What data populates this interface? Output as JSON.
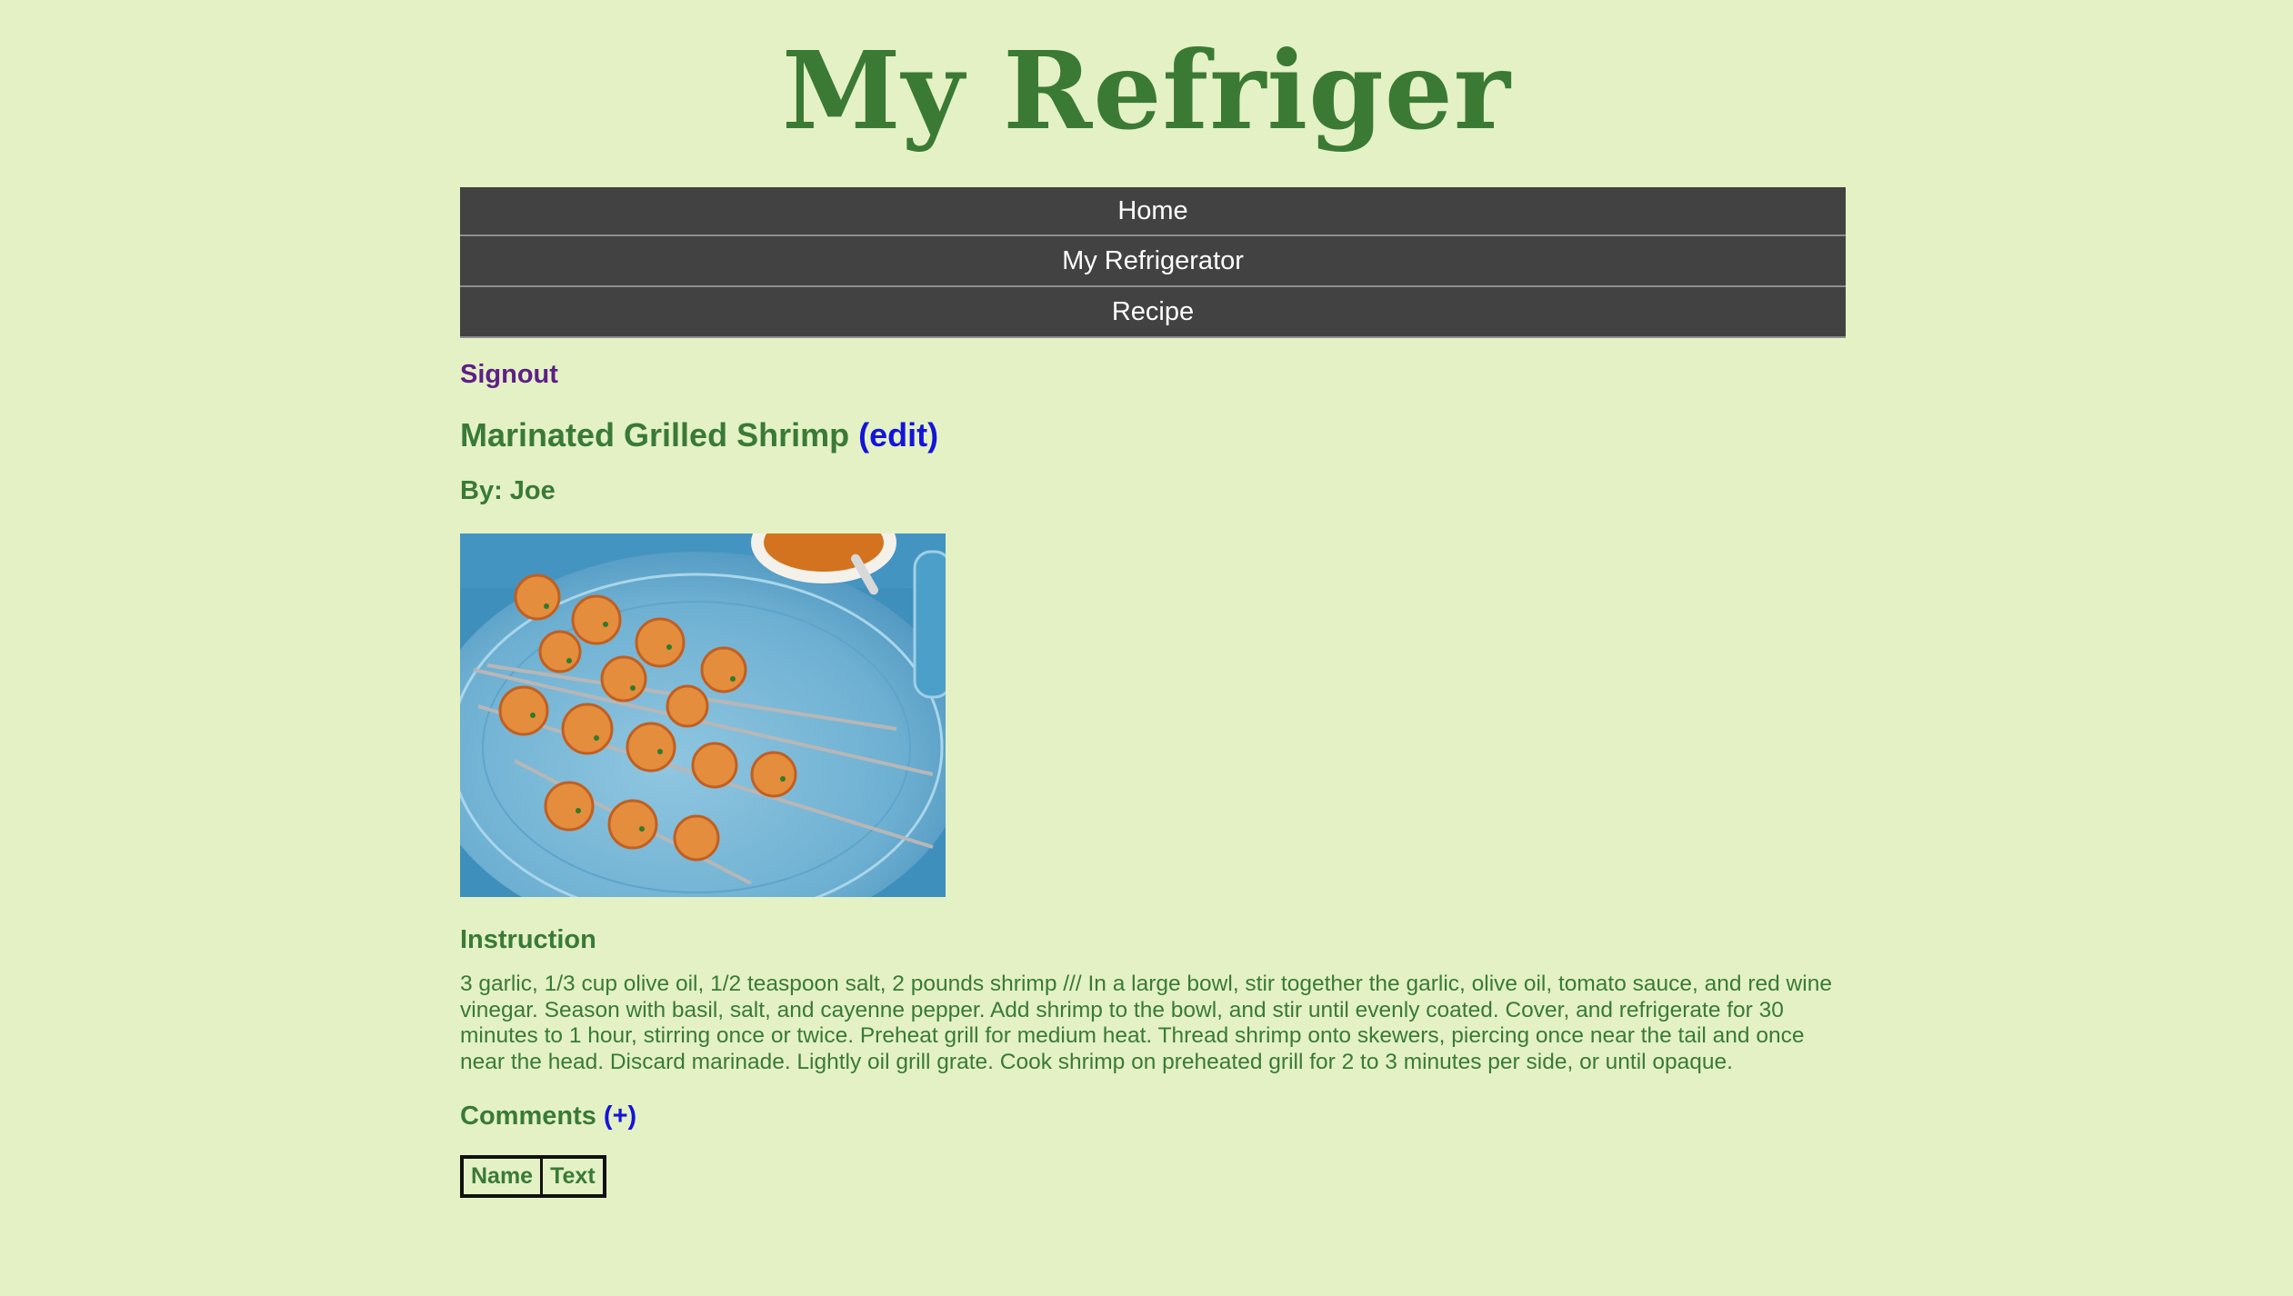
{
  "site": {
    "title": "My Refriger"
  },
  "nav": {
    "items": [
      {
        "label": "Home"
      },
      {
        "label": "My Refrigerator"
      },
      {
        "label": "Recipe"
      }
    ]
  },
  "account": {
    "signout_label": "Signout"
  },
  "recipe": {
    "title": "Marinated Grilled Shrimp",
    "edit_label": "(edit)",
    "author": "By: Joe",
    "image_alt": "grilled-shrimp-skewers-photo",
    "instruction_heading": "Instruction",
    "instructions": "3 garlic, 1/3 cup olive oil, 1/2 teaspoon salt, 2 pounds shrimp /// In a large bowl, stir together the garlic, olive oil, tomato sauce, and red wine vinegar. Season with basil, salt, and cayenne pepper. Add shrimp to the bowl, and stir until evenly coated. Cover, and refrigerate for 30 minutes to 1 hour, stirring once or twice. Preheat grill for medium heat. Thread shrimp onto skewers, piercing once near the tail and once near the head. Discard marinade. Lightly oil grill grate. Cook shrimp on preheated grill for 2 to 3 minutes per side, or until opaque."
  },
  "comments": {
    "heading": "Comments",
    "add_label": "(+)",
    "columns": [
      "Name",
      "Text"
    ]
  },
  "colors": {
    "background": "#e4f1c5",
    "text_green": "#397a36",
    "nav_bg": "#424242",
    "link_blue": "#1414d9",
    "visited_purple": "#5e1f86"
  }
}
